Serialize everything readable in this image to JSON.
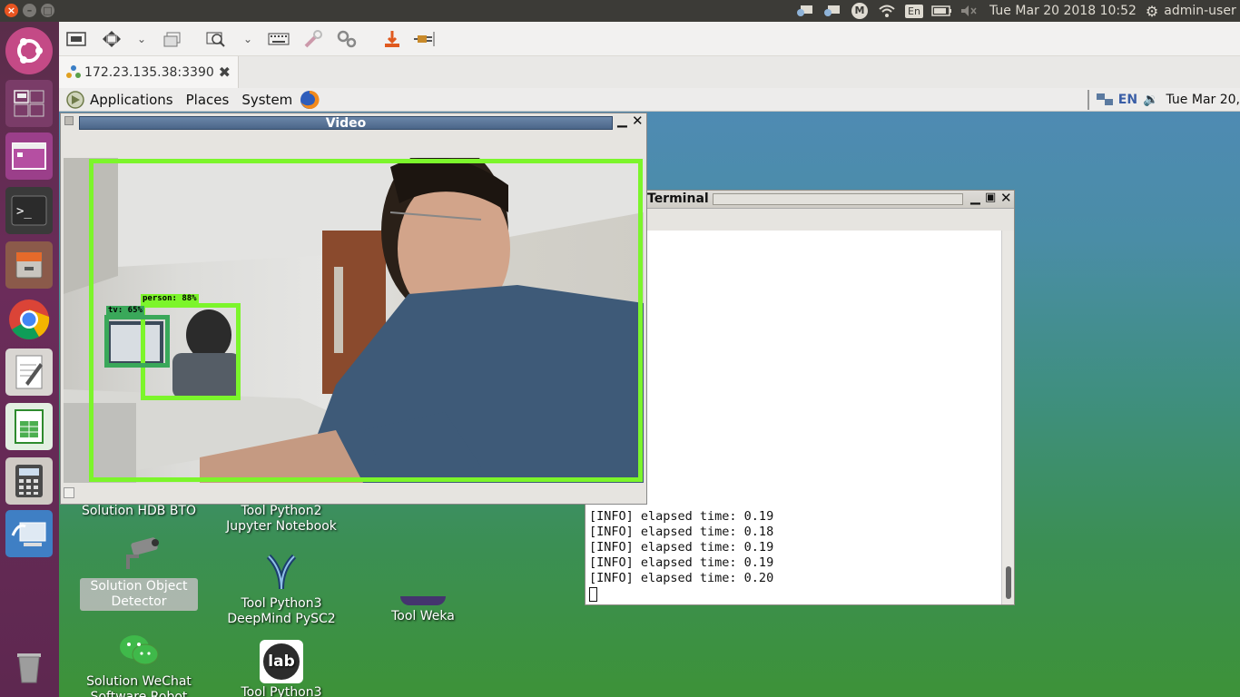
{
  "top_panel": {
    "clock": "Tue Mar 20 2018 10:52",
    "user": "admin-user",
    "tray": [
      "remote-desktop-icon",
      "remote-desktop-icon",
      "mail-icon",
      "wifi-icon",
      "keyboard-layout-icon",
      "battery-icon",
      "volume-mute-icon"
    ],
    "keyboard": "En",
    "mail_letter": "M"
  },
  "launcher": {
    "items": [
      "ubuntu-dash-icon",
      "workspace-icon",
      "presentation-icon",
      "terminal-icon",
      "file-cabinet-icon",
      "chrome-icon",
      "text-editor-icon",
      "spreadsheet-icon",
      "calculator-icon",
      "remote-desktop-viewer-icon",
      "trash-icon"
    ]
  },
  "rdp": {
    "tab_label": "172.23.135.38:3390",
    "tab_close": "✖"
  },
  "remote_panel": {
    "menus": [
      "Applications",
      "Places",
      "System"
    ],
    "lang": "EN",
    "clock": "Tue Mar 20,"
  },
  "desktop_icons": [
    {
      "label": "Solution HDB BTO"
    },
    {
      "label": "Tool Python2 Jupyter Notebook"
    },
    {
      "label": "Solution Object Detector"
    },
    {
      "label": "Tool Python3 DeepMind PySC2"
    },
    {
      "label": "Tool Weka"
    },
    {
      "label": "Solution WeChat Software Robot"
    },
    {
      "label": "Tool Python3"
    }
  ],
  "lab_icon_text": "lab",
  "terminal": {
    "title": "Terminal",
    "lines": [
      "[INFO] elapsed time: 0.19",
      "[INFO] elapsed time: 0.18",
      "[INFO] elapsed time: 0.19",
      "[INFO] elapsed time: 0.19",
      "[INFO] elapsed time: 0.20"
    ]
  },
  "video": {
    "title": "Video",
    "detections": [
      {
        "label": "person: 88%"
      },
      {
        "label": "tv: 65%"
      }
    ]
  },
  "colors": {
    "detection_box": "#7cf52b",
    "launcher_bg": "#5e2850",
    "panel_bg": "#3c3b37"
  }
}
